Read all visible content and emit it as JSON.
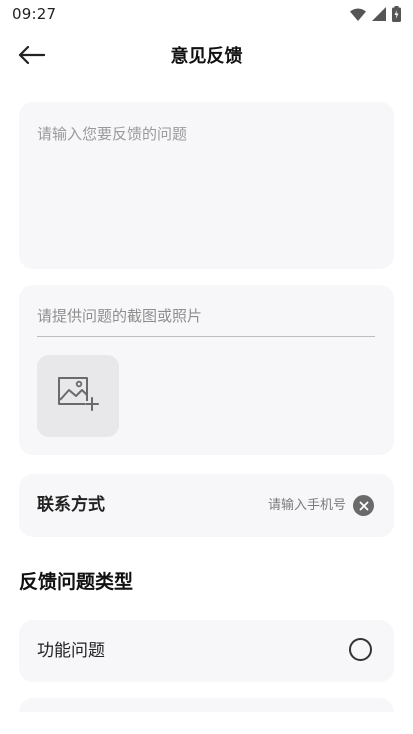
{
  "status_bar": {
    "time": "09:27",
    "icons": [
      "wifi-icon",
      "cellular-signal-icon",
      "battery-charging-icon"
    ]
  },
  "nav": {
    "back_icon": "arrow-left-icon",
    "title": "意见反馈"
  },
  "problem": {
    "placeholder": "请输入您要反馈的问题",
    "value": ""
  },
  "photo": {
    "hint": "请提供问题的截图或照片",
    "add_icon": "image-add-icon"
  },
  "contact": {
    "label": "联系方式",
    "placeholder": "请输入手机号",
    "value": "",
    "clear_icon": "clear-circle-icon"
  },
  "feedback_type": {
    "title": "反馈问题类型",
    "options": [
      {
        "label": "功能问题",
        "selected": false
      }
    ]
  },
  "colors": {
    "card_bg": "#f7f7f9",
    "placeholder": "#9a9a9a",
    "text": "#111111"
  }
}
